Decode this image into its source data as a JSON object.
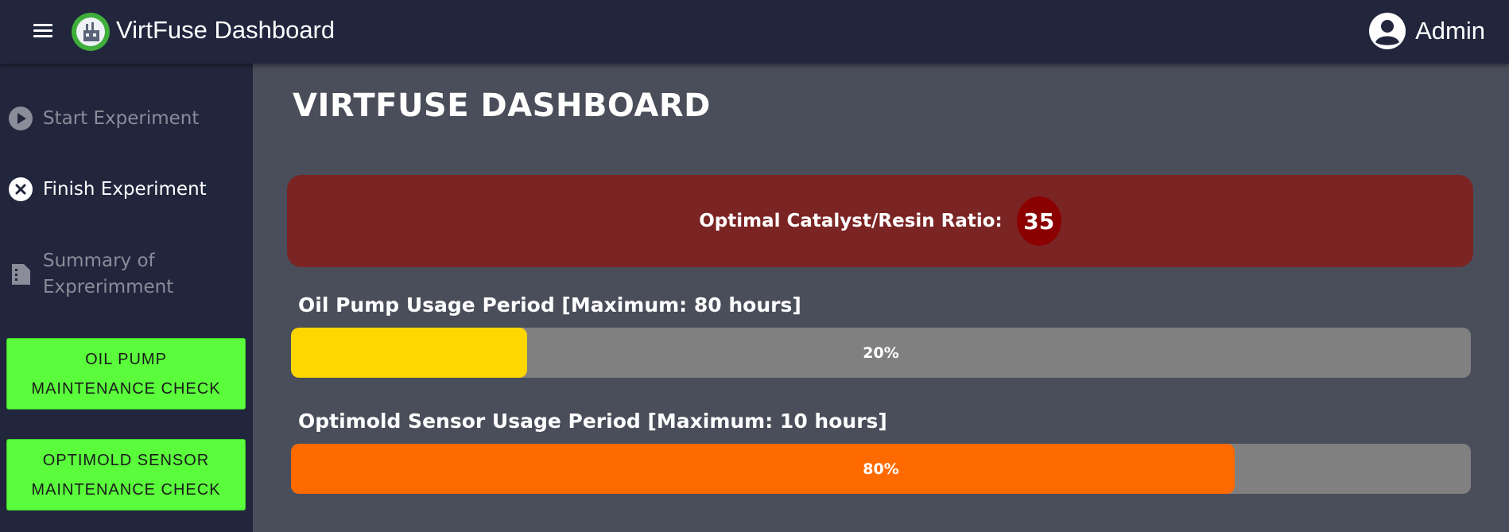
{
  "header": {
    "app_title": "VirtFuse Dashboard",
    "user_label": "Admin",
    "colors": {
      "bar_bg": "#21263d",
      "logo_ring": "#3fae3a"
    }
  },
  "sidebar": {
    "items": [
      {
        "label": "Start Experiment",
        "icon": "play-circle-icon",
        "state": "muted"
      },
      {
        "label": "Finish Experiment",
        "icon": "close-circle-icon",
        "state": "active"
      },
      {
        "label_line1": "Summary of",
        "label_line2": "Exprerimment",
        "icon": "document-icon",
        "state": "muted"
      }
    ],
    "buttons": [
      {
        "line1": "OIL PUMP",
        "line2": "MAINTENANCE CHECK"
      },
      {
        "line1": "OPTIMOLD SENSOR",
        "line2": "MAINTENANCE CHECK"
      }
    ],
    "button_color": "#5afc3c"
  },
  "main": {
    "page_title": "VIRTFUSE DASHBOARD",
    "ratio": {
      "label": "Optimal Catalyst/Resin Ratio:",
      "value": "35",
      "card_color": "#7b2424",
      "badge_color": "#8b0000"
    },
    "usage_bars": [
      {
        "label": "Oil Pump Usage Period [Maximum: 80 hours]",
        "percent": 20,
        "percent_text": "20%",
        "color": "#ffd700"
      },
      {
        "label": "Optimold Sensor Usage Period [Maximum: 10 hours]",
        "percent": 80,
        "percent_text": "80%",
        "color": "#ff6a00"
      }
    ]
  }
}
